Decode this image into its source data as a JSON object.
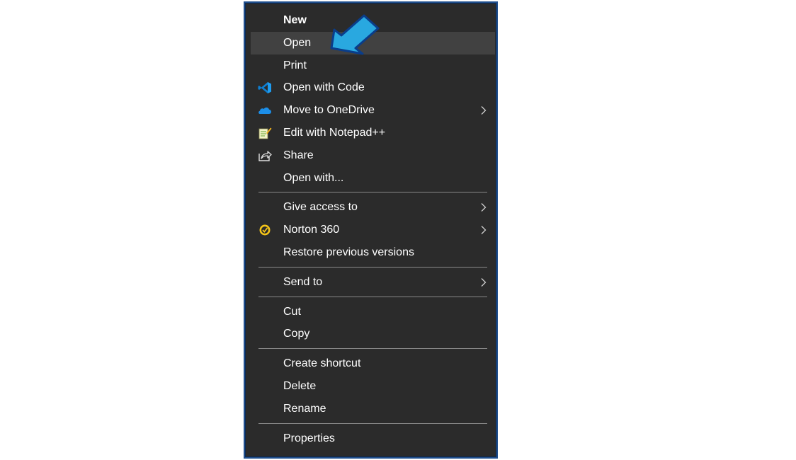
{
  "menu": {
    "items": [
      {
        "label": "New"
      },
      {
        "label": "Open"
      },
      {
        "label": "Print"
      },
      {
        "label": "Open with Code",
        "icon": "vscode-icon"
      },
      {
        "label": "Move to OneDrive",
        "icon": "onedrive-icon"
      },
      {
        "label": "Edit with Notepad++",
        "icon": "notepad-plus-plus-icon"
      },
      {
        "label": "Share",
        "icon": "share-icon"
      },
      {
        "label": "Open with..."
      },
      {
        "label": "Give access to"
      },
      {
        "label": "Norton 360",
        "icon": "norton-icon"
      },
      {
        "label": "Restore previous versions"
      },
      {
        "label": "Send to"
      },
      {
        "label": "Cut"
      },
      {
        "label": "Copy"
      },
      {
        "label": "Create shortcut"
      },
      {
        "label": "Delete"
      },
      {
        "label": "Rename"
      },
      {
        "label": "Properties"
      }
    ],
    "submenu_items": [
      "Move to OneDrive",
      "Give access to",
      "Norton 360",
      "Send to"
    ],
    "highlighted_item": "Open",
    "bold_item": "New"
  },
  "colors": {
    "menu_background": "#2b2b2b",
    "highlight": "#414141",
    "border": "#1f4e8c",
    "callout_arrow": "#29a8e0",
    "text": "#ffffff"
  },
  "annotation": {
    "icon": "pointer-arrow-icon"
  }
}
